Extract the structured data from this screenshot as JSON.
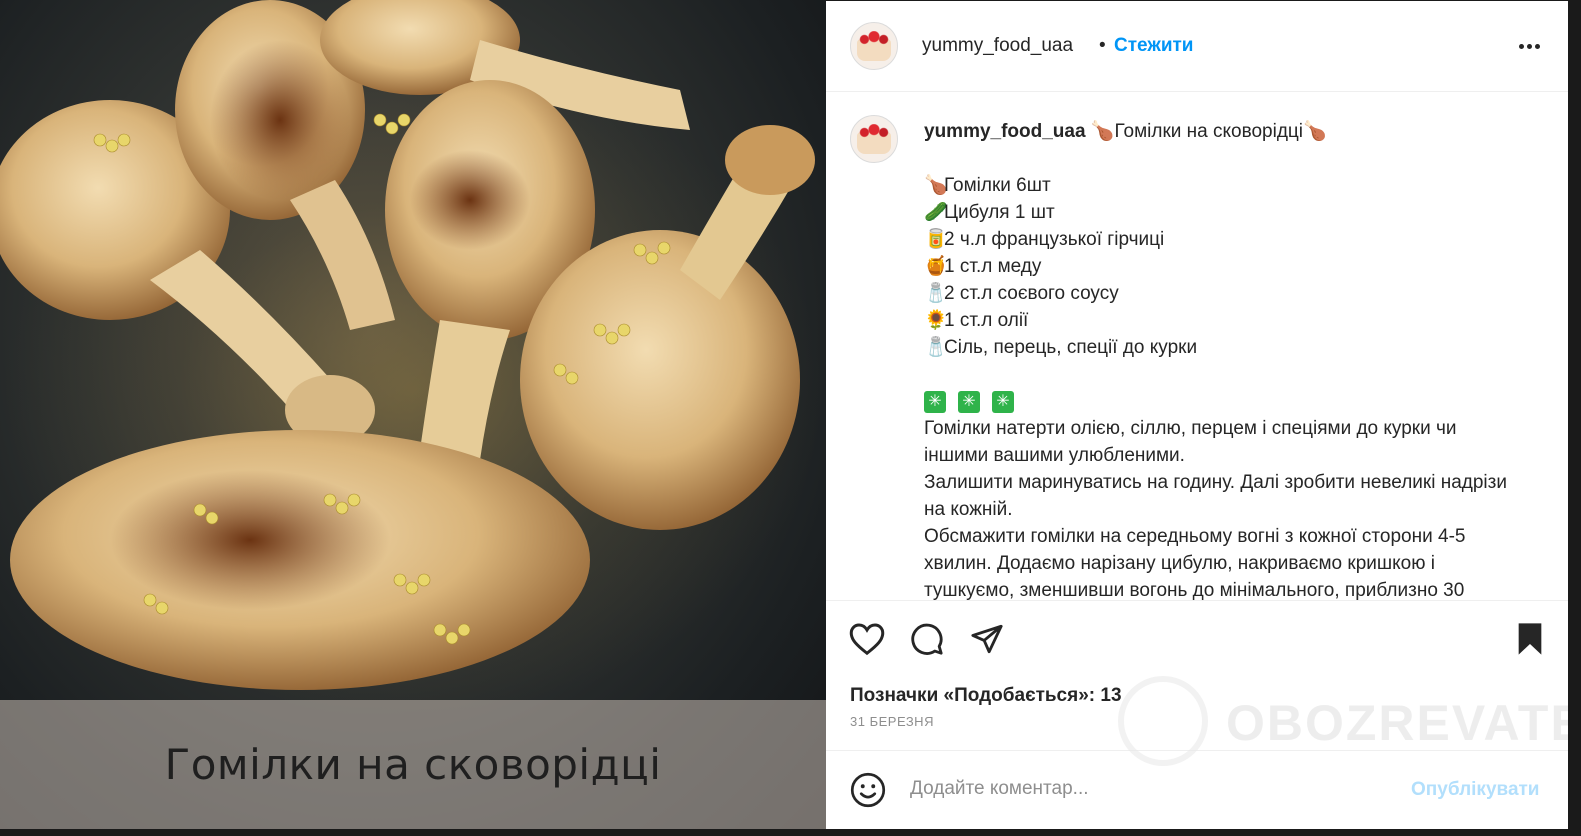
{
  "post": {
    "image_caption": "Гомілки на сковорідці"
  },
  "header": {
    "username": "yummy_food_uaa",
    "separator": "•",
    "follow_label": "Стежити"
  },
  "caption": {
    "username": "yummy_food_uaa",
    "title": "Гомілки на сковорідці",
    "ingredients": [
      {
        "icon": "🍗",
        "text": "Гомілки 6шт"
      },
      {
        "icon": "🥒",
        "text": "Цибуля 1 шт"
      },
      {
        "icon": "🥫",
        "text": "2 ч.л французької гірчиці"
      },
      {
        "icon": "🍯",
        "text": "1 ст.л меду"
      },
      {
        "icon": "🧂",
        "text": "2 ст.л соєвого соусу"
      },
      {
        "icon": "🌻",
        "text": "1 ст.л олії"
      },
      {
        "icon": "🧂",
        "text": "Сіль, перець, спеції до курки"
      }
    ],
    "divider_glyph": "✳",
    "steps": [
      "Гомілки натерти олією, сіллю, перцем і спеціями до курки чи іншими вашими улюбленими.",
      "Залишити маринуватись на годину. Далі зробити невеликі надрізи на кожній.",
      "Обсмажити гомілки на середньому вогні з кожної сторони 4-5 хвилин. Додаємо нарізану цибулю, накриваємо кришкою і тушкуємо, зменшивши вогонь до мінімального, приблизно 30"
    ]
  },
  "actions": {
    "likes_text": "Позначки «Подобається»: 13",
    "date": "31 БЕРЕЗНЯ"
  },
  "comment": {
    "placeholder": "Додайте коментар...",
    "publish_label": "Опублікувати"
  },
  "watermark": {
    "text": "OBOZREVATEL"
  },
  "colors": {
    "accent": "#0095f6",
    "publish_disabled": "#b2dffc",
    "text": "#262626",
    "muted": "#8e8e8e"
  }
}
